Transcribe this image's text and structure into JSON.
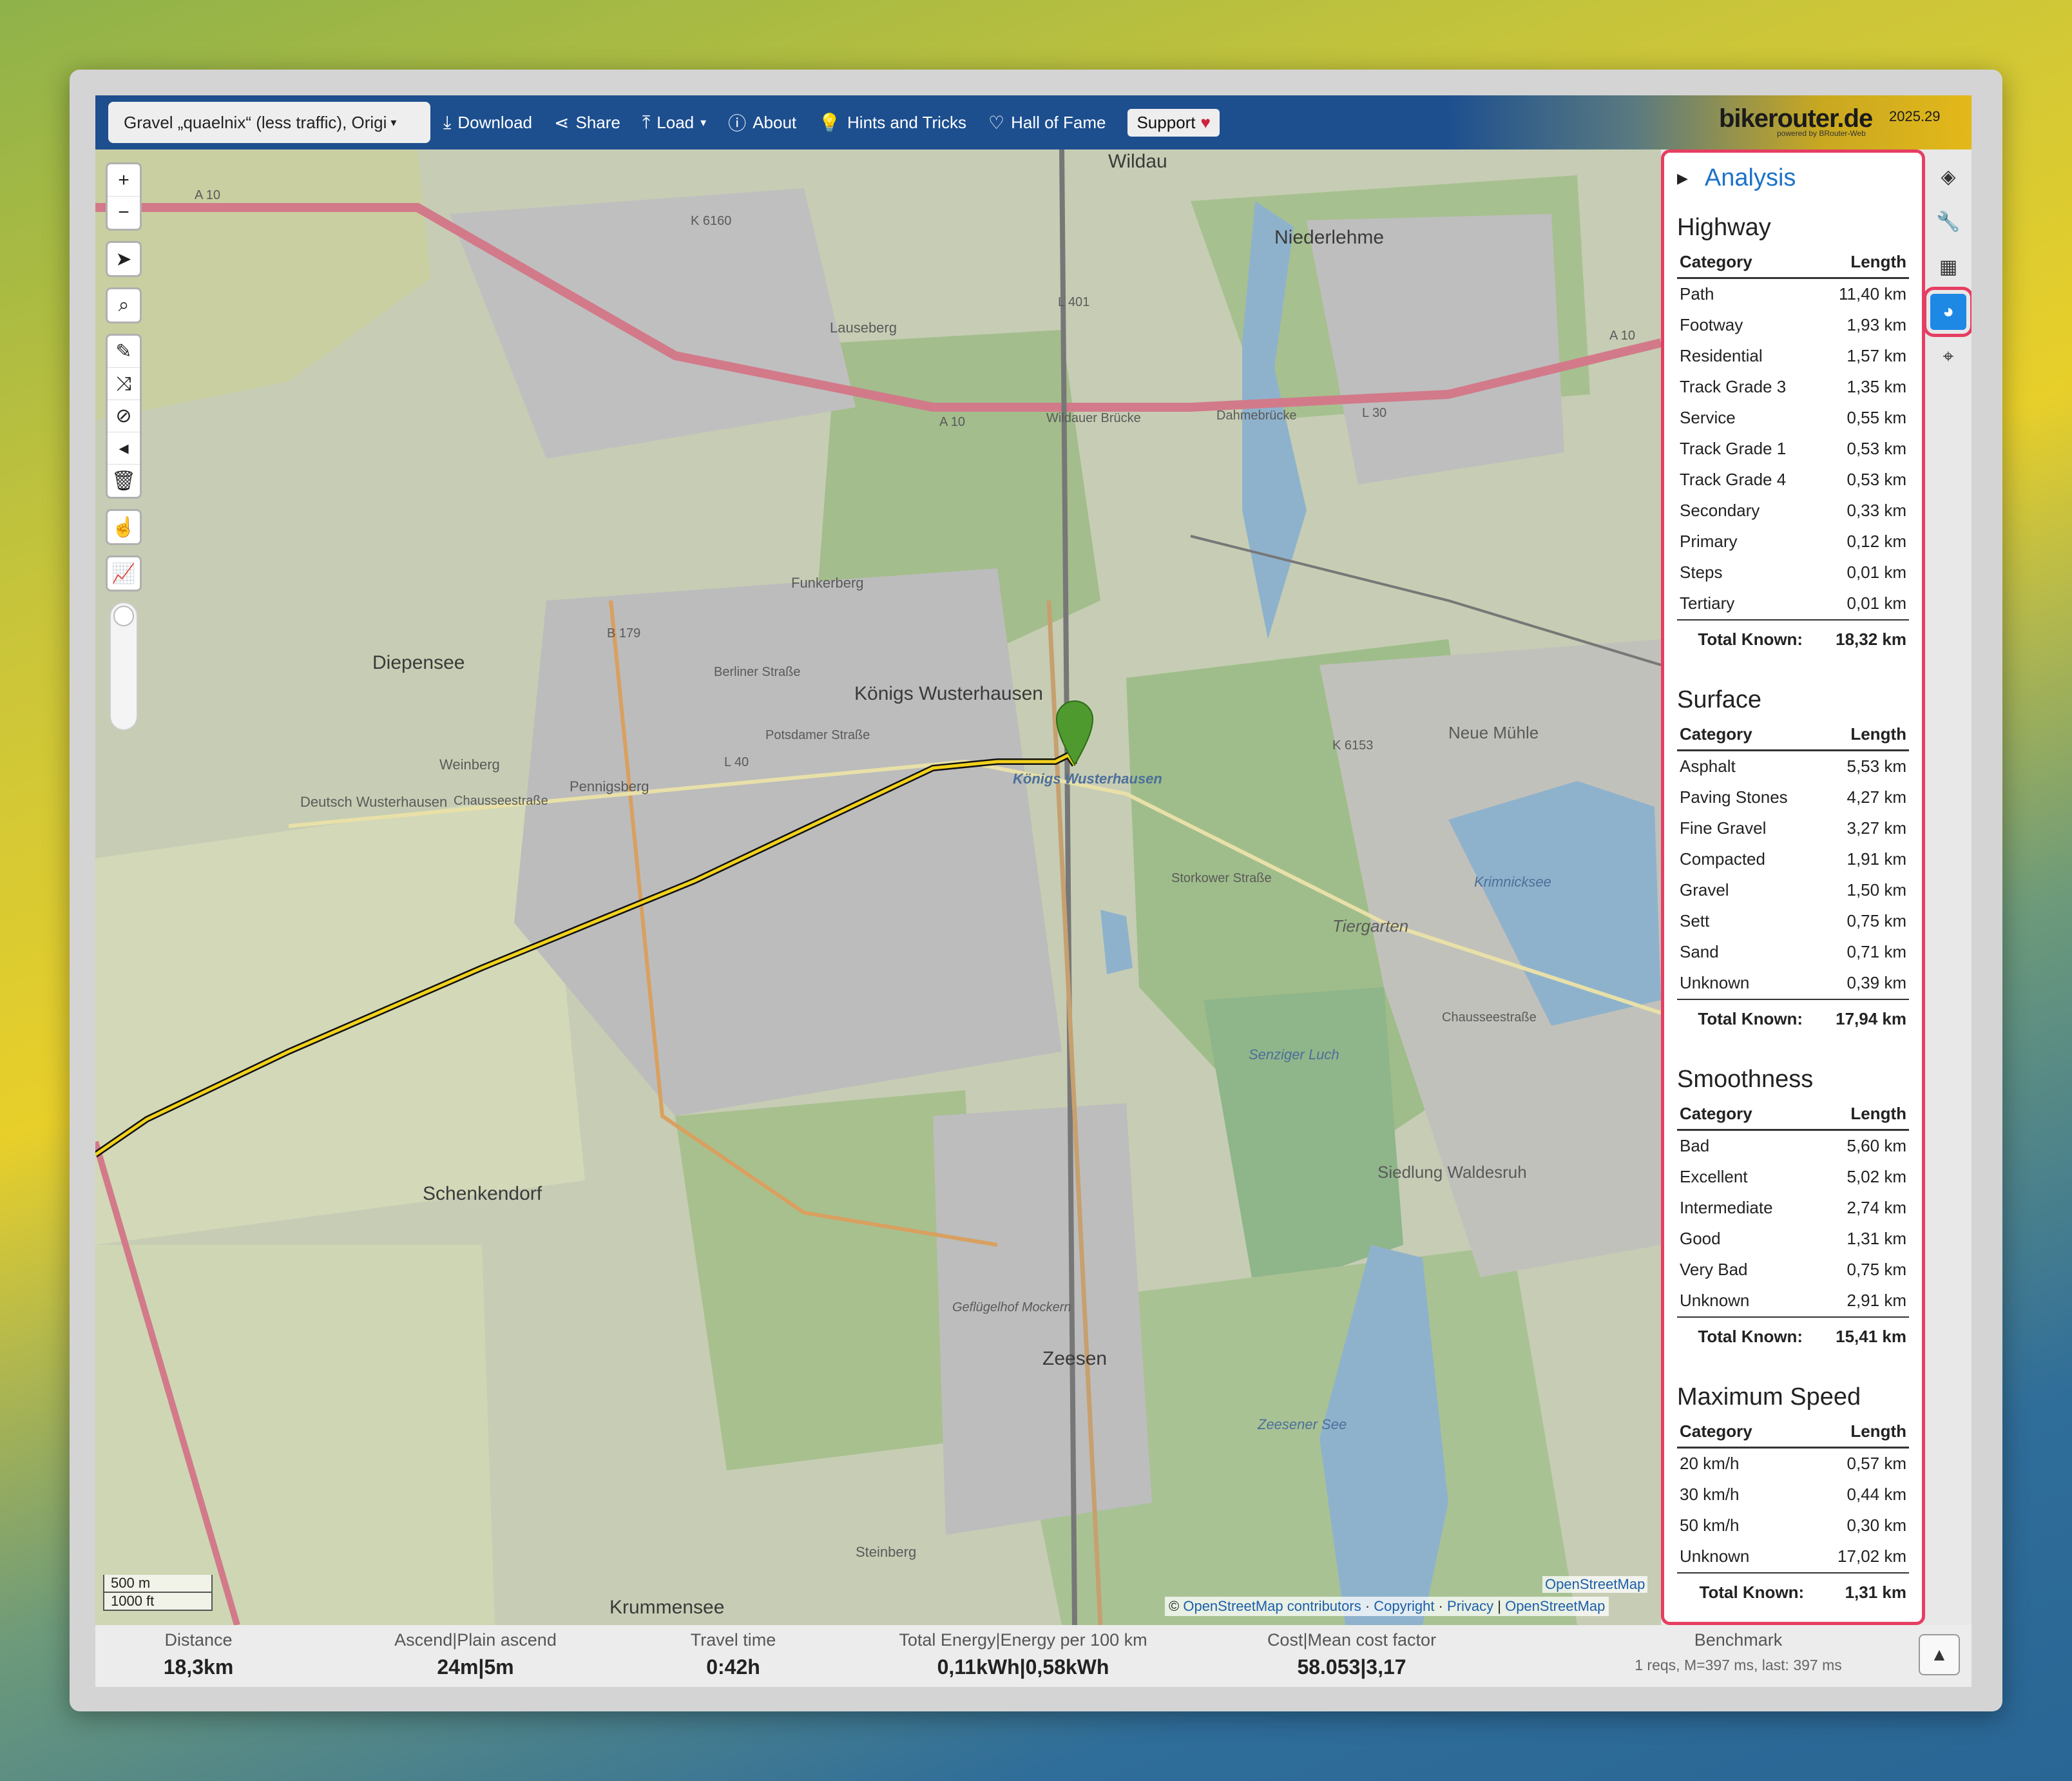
{
  "navbar": {
    "profile": "Gravel „quaelnix“ (less traffic), Origi",
    "download": "Download",
    "share": "Share",
    "load": "Load",
    "about": "About",
    "hints": "Hints and Tricks",
    "hall_of_fame": "Hall of Fame",
    "support": "Support",
    "brand": "bikerouter.de",
    "brand_sub": "powered by BRouter-Web",
    "version": "2025.29"
  },
  "map": {
    "labels": {
      "wildau": "Wildau",
      "niederlehme": "Niederlehme",
      "diepensee": "Diepensee",
      "koenigs": "Königs Wusterhausen",
      "schenkendorf": "Schenkendorf",
      "zeesen": "Zeesen",
      "krummensee": "Krummensee",
      "tiergarten": "Tiergarten",
      "neue_muehle": "Neue Mühle",
      "krimnicksee": "Krimnicksee",
      "siedlung": "Siedlung Waldesruh",
      "deutsch_wh": "Deutsch Wusterhausen",
      "weinberg": "Weinberg",
      "pennigsberg": "Pennigsberg",
      "funkerberg": "Funkerberg",
      "lauseberg": "Lauseberg",
      "senziger": "Senziger Luch",
      "zeesener": "Zeesener See",
      "gefluegelhof": "Geflügelhof Mockern",
      "steinberg": "Steinberg",
      "marker": "Königs Wusterhausen",
      "a10_1": "A 10",
      "a10_2": "A 10",
      "a10_3": "A 10",
      "l401": "L 401",
      "l30": "L 30",
      "l40": "L 40",
      "b179": "B 179",
      "k6160": "K 6160",
      "k6153": "K 6153",
      "dahmebruecke": "Dahmebrücke",
      "wildauer_bruecke": "Wildauer Brücke",
      "potsdamer": "Potsdamer Straße",
      "berliner": "Berliner Straße",
      "storkower": "Storkower Straße",
      "chausseestrasse": "Chausseestraße",
      "chausseestrasse2": "Chausseestraße"
    },
    "scale_m": "500 m",
    "scale_ft": "1000 ft",
    "attribution": {
      "prefix": "©",
      "osm": "OpenStreetMap contributors",
      "copyright": "Copyright",
      "privacy": "Privacy",
      "osm2": "OpenStreetMap",
      "osm_mini": "OpenStreetMap"
    }
  },
  "panel": {
    "title": "Analysis",
    "col_category": "Category",
    "col_length": "Length",
    "total_label": "Total Known:",
    "sections": [
      {
        "title": "Highway",
        "rows": [
          [
            "Path",
            "11,40 km"
          ],
          [
            "Footway",
            "1,93 km"
          ],
          [
            "Residential",
            "1,57 km"
          ],
          [
            "Track Grade 3",
            "1,35 km"
          ],
          [
            "Service",
            "0,55 km"
          ],
          [
            "Track Grade 1",
            "0,53 km"
          ],
          [
            "Track Grade 4",
            "0,53 km"
          ],
          [
            "Secondary",
            "0,33 km"
          ],
          [
            "Primary",
            "0,12 km"
          ],
          [
            "Steps",
            "0,01 km"
          ],
          [
            "Tertiary",
            "0,01 km"
          ]
        ],
        "total": "18,32 km"
      },
      {
        "title": "Surface",
        "rows": [
          [
            "Asphalt",
            "5,53 km"
          ],
          [
            "Paving Stones",
            "4,27 km"
          ],
          [
            "Fine Gravel",
            "3,27 km"
          ],
          [
            "Compacted",
            "1,91 km"
          ],
          [
            "Gravel",
            "1,50 km"
          ],
          [
            "Sett",
            "0,75 km"
          ],
          [
            "Sand",
            "0,71 km"
          ],
          [
            "Unknown",
            "0,39 km"
          ]
        ],
        "total": "17,94 km"
      },
      {
        "title": "Smoothness",
        "rows": [
          [
            "Bad",
            "5,60 km"
          ],
          [
            "Excellent",
            "5,02 km"
          ],
          [
            "Intermediate",
            "2,74 km"
          ],
          [
            "Good",
            "1,31 km"
          ],
          [
            "Very Bad",
            "0,75 km"
          ],
          [
            "Unknown",
            "2,91 km"
          ]
        ],
        "total": "15,41 km"
      },
      {
        "title": "Maximum Speed",
        "rows": [
          [
            "20 km/h",
            "0,57 km"
          ],
          [
            "30 km/h",
            "0,44 km"
          ],
          [
            "50 km/h",
            "0,30 km"
          ],
          [
            "Unknown",
            "17,02 km"
          ]
        ],
        "total": "1,31 km"
      }
    ]
  },
  "footer": {
    "distance_label": "Distance",
    "distance": "18,3km",
    "ascend_label": "Ascend|Plain ascend",
    "ascend": "24m|5m",
    "time_label": "Travel time",
    "time": "0:42h",
    "energy_label": "Total Energy|Energy per 100 km",
    "energy": "0,11kWh|0,58kWh",
    "cost_label": "Cost|Mean cost factor",
    "cost": "58.053|3,17",
    "bench_label": "Benchmark",
    "bench": "1 reqs, M=397 ms, last: 397 ms"
  },
  "colors": {
    "accent": "#1e88e5",
    "highlight": "#e63e62",
    "navbar": "#1d4f8f",
    "route": "#f2d21b"
  }
}
